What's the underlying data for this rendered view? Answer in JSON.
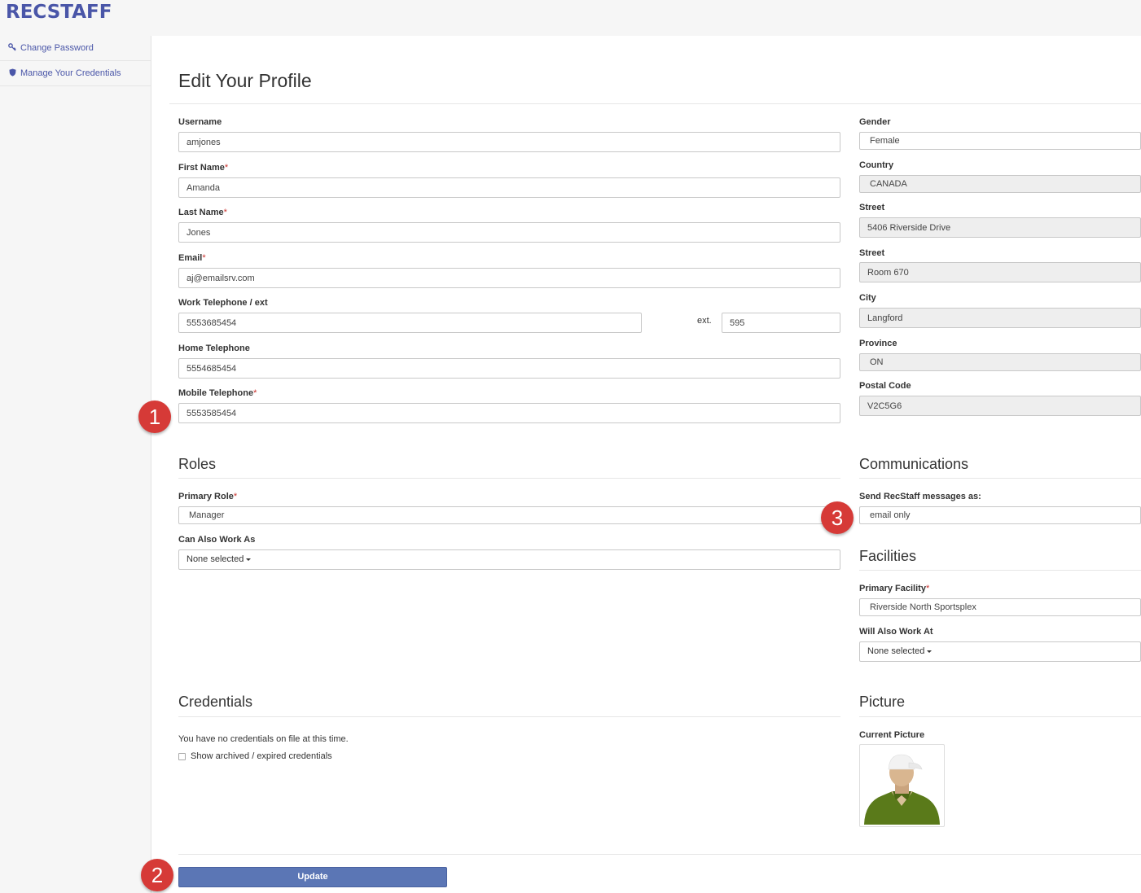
{
  "app": {
    "logo": "RECSTAFF"
  },
  "sidebar": {
    "items": [
      {
        "label": "Change Password",
        "icon": "key-icon"
      },
      {
        "label": "Manage Your Credentials",
        "icon": "shield-icon"
      }
    ]
  },
  "page": {
    "title": "Edit Your Profile"
  },
  "profile": {
    "username_label": "Username",
    "username": "amjones",
    "first_name_label": "First Name",
    "first_name": "Amanda",
    "last_name_label": "Last Name",
    "last_name": "Jones",
    "email_label": "Email",
    "email": "aj@emailsrv.com",
    "work_phone_label": "Work Telephone / ext",
    "work_phone": "5553685454",
    "ext_label": "ext.",
    "ext": "595",
    "home_phone_label": "Home Telephone",
    "home_phone": "5554685454",
    "mobile_phone_label": "Mobile Telephone",
    "mobile_phone": "5553585454",
    "required_marker": "*"
  },
  "address": {
    "gender_label": "Gender",
    "gender": "Female",
    "country_label": "Country",
    "country": "CANADA",
    "street1_label": "Street",
    "street1": "5406 Riverside Drive",
    "street2_label": "Street",
    "street2": "Room 670",
    "city_label": "City",
    "city": "Langford",
    "province_label": "Province",
    "province": "ON",
    "postal_label": "Postal Code",
    "postal": "V2C5G6"
  },
  "roles": {
    "heading": "Roles",
    "primary_label": "Primary Role",
    "primary": "Manager",
    "also_label": "Can Also Work As",
    "also": "None selected"
  },
  "communications": {
    "heading": "Communications",
    "send_label": "Send RecStaff messages as:",
    "send": "email only"
  },
  "facilities": {
    "heading": "Facilities",
    "primary_label": "Primary Facility",
    "primary": "Riverside North Sportsplex",
    "also_label": "Will Also Work At",
    "also": "None selected"
  },
  "credentials": {
    "heading": "Credentials",
    "empty_text": "You have no credentials on file at this time.",
    "show_archived_label": "Show archived / expired credentials",
    "show_archived_checked": false
  },
  "picture": {
    "heading": "Picture",
    "current_label": "Current Picture"
  },
  "actions": {
    "update_label": "Update"
  },
  "callouts": [
    "1",
    "2",
    "3"
  ],
  "colors": {
    "brand": "#4a56a8",
    "button": "#5b76b5",
    "required": "#c9302c",
    "callout": "#d63a37"
  }
}
